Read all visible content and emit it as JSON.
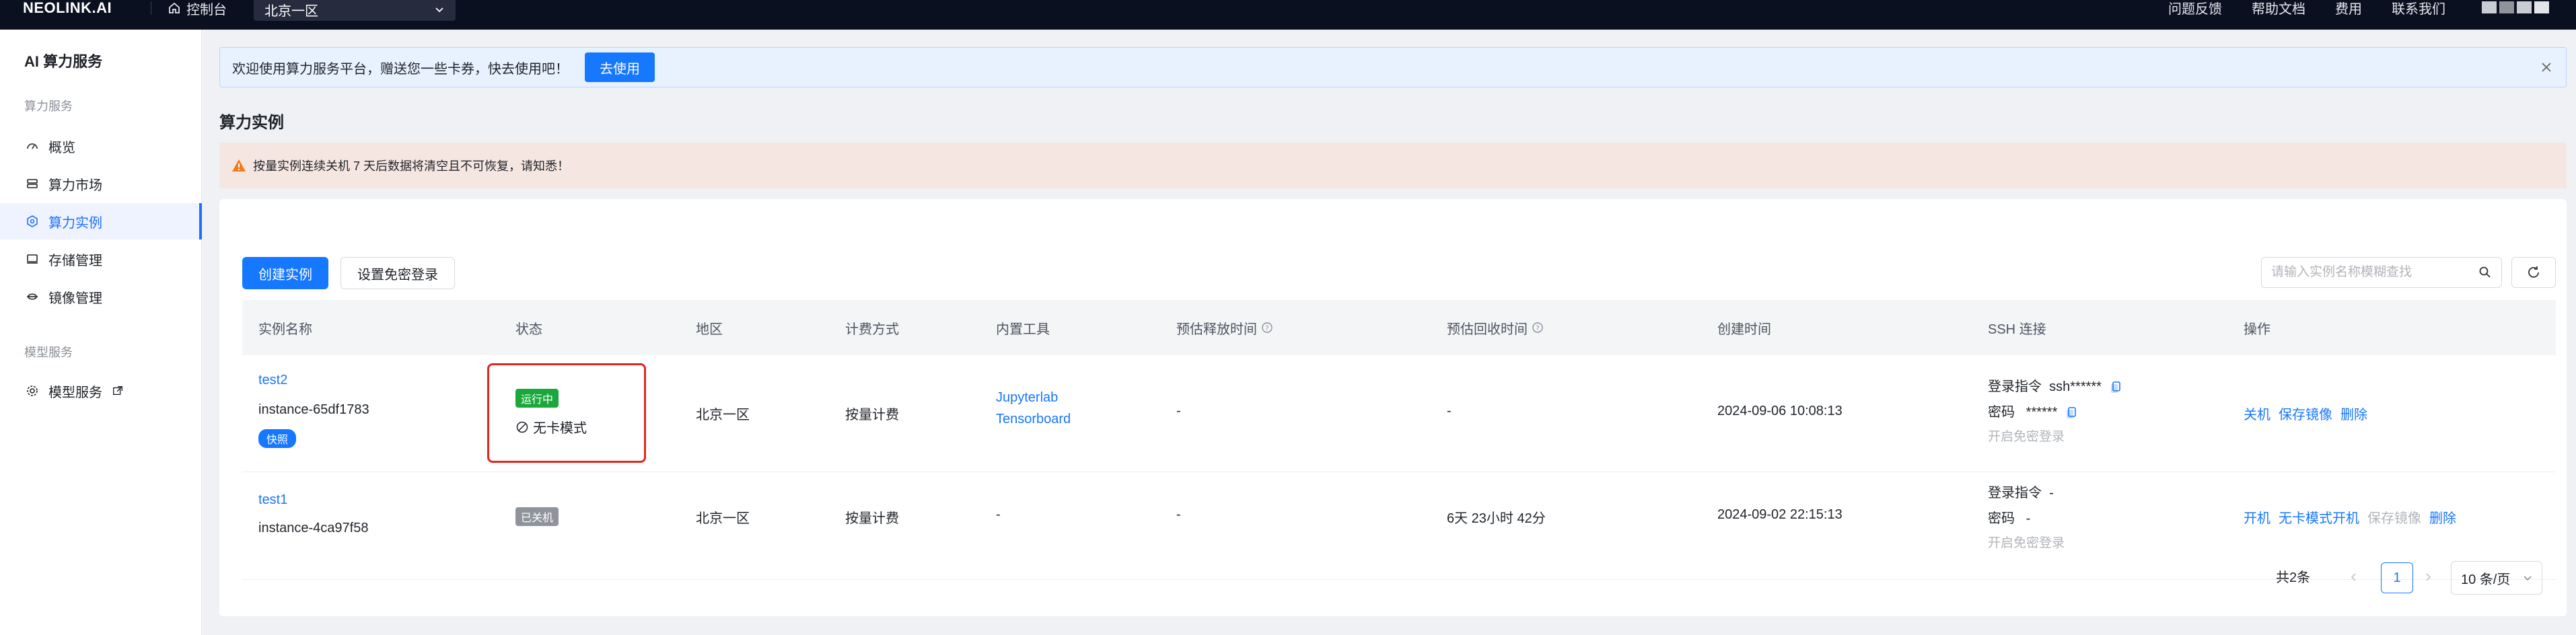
{
  "topbar": {
    "logo": "NEOLINK.AI",
    "console": "控制台",
    "region": "北京一区",
    "links": [
      "问题反馈",
      "帮助文档",
      "费用",
      "联系我们"
    ]
  },
  "sidebar": {
    "title": "AI 算力服务",
    "group1": "算力服务",
    "items": [
      {
        "label": "概览",
        "icon": "dashboard-icon"
      },
      {
        "label": "算力市场",
        "icon": "market-icon"
      },
      {
        "label": "算力实例",
        "icon": "instance-icon"
      },
      {
        "label": "存储管理",
        "icon": "storage-icon"
      },
      {
        "label": "镜像管理",
        "icon": "image-icon"
      }
    ],
    "group2": "模型服务",
    "model_item": "模型服务"
  },
  "notice": {
    "text": "欢迎使用算力服务平台，赠送您一些卡券，快去使用吧！",
    "button": "去使用"
  },
  "page_title": "算力实例",
  "warning": "按量实例连续关机 7 天后数据将清空且不可恢复，请知悉！",
  "toolbar": {
    "create": "创建实例",
    "passwordless": "设置免密登录",
    "search_placeholder": "请输入实例名称模糊查找"
  },
  "columns": [
    "实例名称",
    "状态",
    "地区",
    "计费方式",
    "内置工具",
    "预估释放时间",
    "预估回收时间",
    "创建时间",
    "SSH 连接",
    "操作"
  ],
  "rows": [
    {
      "name": "test2",
      "id": "instance-65df1783",
      "badge": "快照",
      "status": "运行中",
      "mode": "无卡模式",
      "region": "北京一区",
      "billing": "按量计费",
      "tools": [
        "Jupyterlab",
        "Tensorboard"
      ],
      "release": "-",
      "recycle": "-",
      "created": "2024-09-06 10:08:13",
      "ssh_cmd_label": "登录指令",
      "ssh_cmd": "ssh******",
      "ssh_pwd_label": "密码",
      "ssh_pwd": "******",
      "ssh_passwordless": "开启免密登录",
      "actions": [
        "关机",
        "保存镜像",
        "删除"
      ]
    },
    {
      "name": "test1",
      "id": "instance-4ca97f58",
      "status": "已关机",
      "region": "北京一区",
      "billing": "按量计费",
      "tools": "-",
      "release": "-",
      "recycle": "6天 23小时 42分",
      "created": "2024-09-02 22:15:13",
      "ssh_cmd_label": "登录指令",
      "ssh_cmd": "-",
      "ssh_pwd_label": "密码",
      "ssh_pwd": "-",
      "ssh_passwordless": "开启免密登录",
      "actions": [
        "开机",
        "无卡模式开机",
        "保存镜像",
        "删除"
      ]
    }
  ],
  "pagination": {
    "total": "共2条",
    "page": "1",
    "page_size": "10 条/页"
  }
}
